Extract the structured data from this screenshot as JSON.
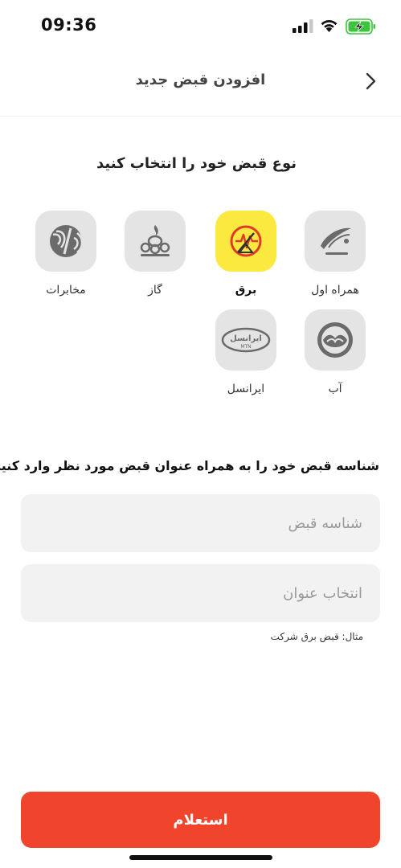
{
  "status_bar": {
    "time": "09:36",
    "icons": [
      "cellular-signal-icon",
      "wifi-icon",
      "battery-charging-icon"
    ],
    "battery_color": "#3dc43d"
  },
  "header": {
    "title": "افزودن قبض جدید",
    "back_icon": "chevron-right-icon"
  },
  "bill_type": {
    "title": "نوع قبض خود را انتخاب کنید",
    "selected": "برق",
    "selected_color": "#fce940",
    "items": [
      {
        "label": "همراه اول",
        "icon": "hamrah-aval-logo-icon"
      },
      {
        "label": "برق",
        "icon": "electricity-logo-icon"
      },
      {
        "label": "گاز",
        "icon": "gas-logo-icon"
      },
      {
        "label": "مخابرات",
        "icon": "telecom-logo-icon"
      },
      {
        "label": "آب",
        "icon": "water-logo-icon"
      },
      {
        "label": "ایرانسل",
        "icon": "irancell-logo-icon"
      }
    ],
    "irancell_logo_text": "ایرانسل",
    "irancell_logo_sub": "MTN"
  },
  "identification": {
    "title": "شناسه قبض خود را به همراه عنوان قبض مورد نظر وارد کنید",
    "bill_id_placeholder": "شناسه قبض",
    "bill_id_value": "",
    "title_placeholder": "انتخاب عنوان",
    "title_value": "",
    "hint": "مثال: قبض برق شرکت"
  },
  "submit": {
    "label": "استعلام",
    "color": "#f0442c"
  }
}
